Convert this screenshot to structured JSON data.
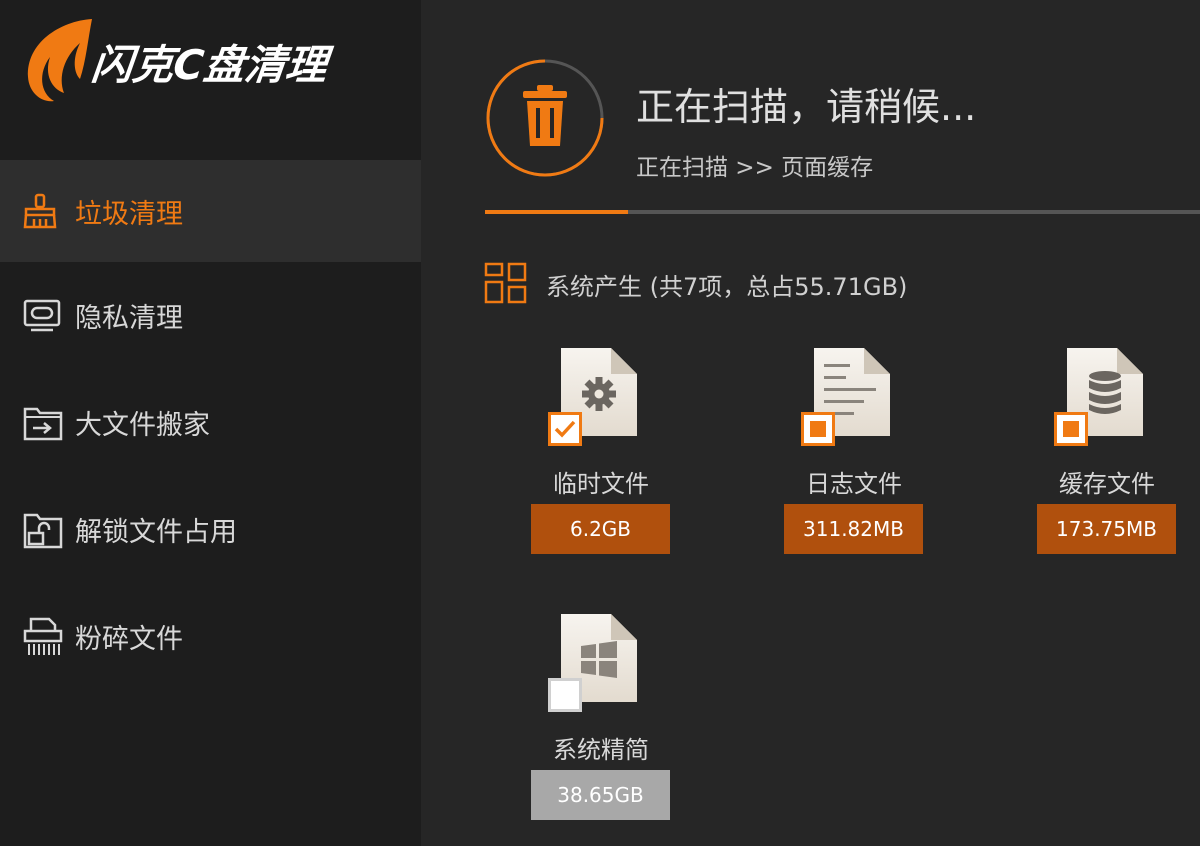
{
  "app": {
    "title": "闪克C盘清理"
  },
  "sidebar": {
    "items": [
      {
        "label": "垃圾清理",
        "icon": "broom-icon",
        "active": true
      },
      {
        "label": "隐私清理",
        "icon": "monitor-eye-icon",
        "active": false
      },
      {
        "label": "大文件搬家",
        "icon": "folder-move-icon",
        "active": false
      },
      {
        "label": "解锁文件占用",
        "icon": "folder-unlock-icon",
        "active": false
      },
      {
        "label": "粉碎文件",
        "icon": "shredder-icon",
        "active": false
      }
    ]
  },
  "scan": {
    "title": "正在扫描，请稍候...",
    "path": "正在扫描 >> 页面缓存",
    "progress_percent": 20,
    "icon": "trash-icon"
  },
  "section": {
    "title": "系统产生 (共7项，总占55.71GB)",
    "icon": "grid-icon"
  },
  "items": [
    {
      "label": "临时文件",
      "size": "6.2GB",
      "icon": "gear-file-icon",
      "check": "checked"
    },
    {
      "label": "日志文件",
      "size": "311.82MB",
      "icon": "text-file-icon",
      "check": "partial"
    },
    {
      "label": "缓存文件",
      "size": "173.75MB",
      "icon": "database-file-icon",
      "check": "partial"
    },
    {
      "label": "系统精简",
      "size": "38.65GB",
      "icon": "windows-file-icon",
      "check": "unchecked"
    }
  ],
  "colors": {
    "accent": "#f07a13",
    "size_badge": "#b0500d",
    "size_badge_disabled": "#a8a8a8",
    "sidebar_bg": "#1d1d1d",
    "main_bg": "#262626"
  }
}
